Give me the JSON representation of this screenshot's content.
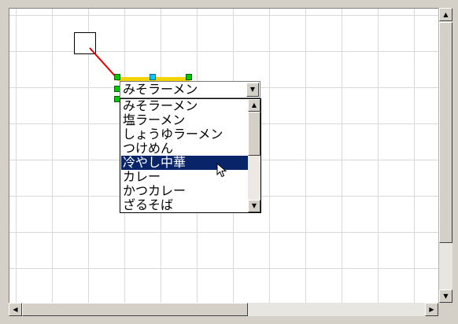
{
  "combo": {
    "selected_value": "みそラーメン",
    "options": [
      "みそラーメン",
      "塩ラーメン",
      "しょうゆラーメン",
      "つけめん",
      "冷やし中華",
      "カレー",
      "かつカレー",
      "ざるそば"
    ],
    "highlighted_option": "冷やし中華"
  },
  "icons": {
    "dropdown_arrow": "▼",
    "scroll_up": "▲",
    "scroll_down": "▼",
    "scroll_left": "◀",
    "scroll_right": "▶"
  },
  "colors": {
    "selection_bg": "#0a246a",
    "connector_line": "#e00000",
    "handle_green": "#00c800",
    "handle_cyan": "#00c8ff",
    "yellow_bar": "#f4d400"
  }
}
